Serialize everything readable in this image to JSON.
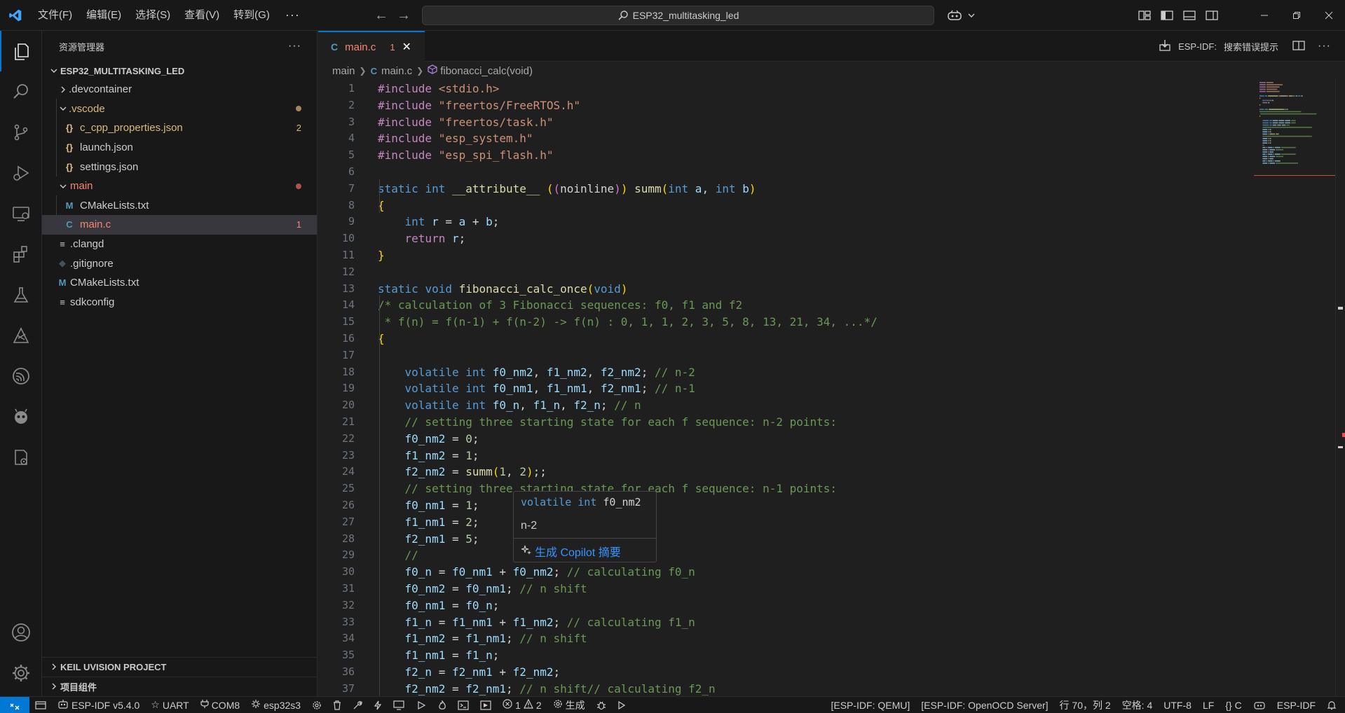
{
  "titlebar": {
    "menus": [
      "文件(F)",
      "编辑(E)",
      "选择(S)",
      "查看(V)",
      "转到(G)"
    ],
    "more": "···",
    "search_text": "ESP32_multitasking_led"
  },
  "sidebar": {
    "title": "资源管理器",
    "more": "···",
    "project": "ESP32_MULTITASKING_LED",
    "items": [
      {
        "label": ".devcontainer",
        "badge": ""
      },
      {
        "label": ".vscode",
        "badge": ""
      },
      {
        "label": "c_cpp_properties.json",
        "badge": "2"
      },
      {
        "label": "launch.json",
        "badge": ""
      },
      {
        "label": "settings.json",
        "badge": ""
      },
      {
        "label": "main",
        "badge": ""
      },
      {
        "label": "CMakeLists.txt",
        "badge": ""
      },
      {
        "label": "main.c",
        "badge": "1"
      },
      {
        "label": ".clangd",
        "badge": ""
      },
      {
        "label": ".gitignore",
        "badge": ""
      },
      {
        "label": "CMakeLists.txt",
        "badge": ""
      },
      {
        "label": "sdkconfig",
        "badge": ""
      }
    ],
    "sections": [
      "KEIL UVISION PROJECT",
      "项目组件"
    ]
  },
  "tab": {
    "icon": "C",
    "name": "main.c",
    "problems": "1",
    "close": "✕"
  },
  "editor_actions": {
    "label": "ESP-IDF:",
    "search": "搜索错误提示"
  },
  "breadcrumb": {
    "folder": "main",
    "file": "main.c",
    "symbol": "fibonacci_calc(void)"
  },
  "code": {
    "lines": [
      [
        [
          "#include ",
          "pre"
        ],
        [
          "<stdio.h>",
          "str"
        ]
      ],
      [
        [
          "#include ",
          "pre"
        ],
        [
          "\"freertos/FreeRTOS.h\"",
          "str"
        ]
      ],
      [
        [
          "#include ",
          "pre"
        ],
        [
          "\"freertos/task.h\"",
          "str"
        ]
      ],
      [
        [
          "#include ",
          "pre"
        ],
        [
          "\"esp_system.h\"",
          "str"
        ]
      ],
      [
        [
          "#include ",
          "pre"
        ],
        [
          "\"esp_spi_flash.h\"",
          "str"
        ]
      ],
      [],
      [
        [
          "static ",
          "kw"
        ],
        [
          "int ",
          "kw"
        ],
        [
          "__attribute__ ",
          "fn"
        ],
        [
          "(",
          "br1"
        ],
        [
          "(",
          "br2"
        ],
        [
          "noinline",
          "plain"
        ],
        [
          ")",
          "br2"
        ],
        [
          ")",
          "br1"
        ],
        [
          " summ",
          "fn"
        ],
        [
          "(",
          "br1"
        ],
        [
          "int ",
          "kw"
        ],
        [
          "a",
          "var"
        ],
        [
          ", ",
          "plain"
        ],
        [
          "int ",
          "kw"
        ],
        [
          "b",
          "var"
        ],
        [
          ")",
          "br1"
        ]
      ],
      [
        [
          "{",
          "br1"
        ]
      ],
      [
        [
          "    int ",
          "kw"
        ],
        [
          "r",
          "var"
        ],
        [
          " = ",
          "plain"
        ],
        [
          "a",
          "var"
        ],
        [
          " + ",
          "plain"
        ],
        [
          "b",
          "var"
        ],
        [
          ";",
          "plain"
        ]
      ],
      [
        [
          "    return ",
          "ctl"
        ],
        [
          "r",
          "var"
        ],
        [
          ";",
          "plain"
        ]
      ],
      [
        [
          "}",
          "br1"
        ]
      ],
      [],
      [
        [
          "static ",
          "kw"
        ],
        [
          "void ",
          "kw"
        ],
        [
          "fibonacci_calc_once",
          "fn"
        ],
        [
          "(",
          "br1"
        ],
        [
          "void",
          "kw"
        ],
        [
          ")",
          "br1"
        ]
      ],
      [
        [
          "/* calculation of 3 Fibonacci sequences: f0, f1 and f2",
          "cmt"
        ]
      ],
      [
        [
          " * f(n) = f(n-1) + f(n-2) -> f(n) : 0, 1, 1, 2, 3, 5, 8, 13, 21, 34, ...*/",
          "cmt"
        ]
      ],
      [
        [
          "{",
          "br1"
        ]
      ],
      [],
      [
        [
          "    volatile ",
          "kw"
        ],
        [
          "int ",
          "kw"
        ],
        [
          "f0_nm2",
          "var"
        ],
        [
          ", ",
          "plain"
        ],
        [
          "f1_nm2",
          "var"
        ],
        [
          ", ",
          "plain"
        ],
        [
          "f2_nm2",
          "var"
        ],
        [
          "; ",
          "plain"
        ],
        [
          "// n-2",
          "cmt"
        ]
      ],
      [
        [
          "    volatile ",
          "kw"
        ],
        [
          "int ",
          "kw"
        ],
        [
          "f0_nm1",
          "var"
        ],
        [
          ", ",
          "plain"
        ],
        [
          "f1_nm1",
          "var"
        ],
        [
          ", ",
          "plain"
        ],
        [
          "f2_nm1",
          "var"
        ],
        [
          "; ",
          "plain"
        ],
        [
          "// n-1",
          "cmt"
        ]
      ],
      [
        [
          "    volatile ",
          "kw"
        ],
        [
          "int ",
          "kw"
        ],
        [
          "f0_n",
          "var"
        ],
        [
          ", ",
          "plain"
        ],
        [
          "f1_n",
          "var"
        ],
        [
          ", ",
          "plain"
        ],
        [
          "f2_n",
          "var"
        ],
        [
          "; ",
          "plain"
        ],
        [
          "// n",
          "cmt"
        ]
      ],
      [
        [
          "    // setting three starting state for each f sequence: n-2 points:",
          "cmt"
        ]
      ],
      [
        [
          "    f0_nm2",
          "var"
        ],
        [
          " = ",
          "plain"
        ],
        [
          "0",
          "num"
        ],
        [
          ";",
          "plain"
        ]
      ],
      [
        [
          "    f1_nm2",
          "var"
        ],
        [
          " = ",
          "plain"
        ],
        [
          "1",
          "num"
        ],
        [
          ";",
          "plain"
        ]
      ],
      [
        [
          "    f2_nm2",
          "var"
        ],
        [
          " = ",
          "plain"
        ],
        [
          "summ",
          "fn"
        ],
        [
          "(",
          "br1"
        ],
        [
          "1",
          "num"
        ],
        [
          ", ",
          "plain"
        ],
        [
          "2",
          "num"
        ],
        [
          ")",
          "br1"
        ],
        [
          ";;",
          "plain"
        ]
      ],
      [
        [
          "    // setting three starting state for each f sequence: n-1 points:",
          "cmt"
        ]
      ],
      [
        [
          "    f0_nm1",
          "var"
        ],
        [
          " = ",
          "plain"
        ],
        [
          "1",
          "num"
        ],
        [
          ";",
          "plain"
        ]
      ],
      [
        [
          "    f1_nm1",
          "var"
        ],
        [
          " = ",
          "plain"
        ],
        [
          "2",
          "num"
        ],
        [
          ";",
          "plain"
        ]
      ],
      [
        [
          "    f2_nm1",
          "var"
        ],
        [
          " = ",
          "plain"
        ],
        [
          "5",
          "num"
        ],
        [
          ";",
          "plain"
        ]
      ],
      [
        [
          "    //",
          "cmt"
        ]
      ],
      [
        [
          "    f0_n",
          "var"
        ],
        [
          " = ",
          "plain"
        ],
        [
          "f0_nm1",
          "var"
        ],
        [
          " + ",
          "plain"
        ],
        [
          "f0_nm2",
          "var"
        ],
        [
          "; ",
          "plain"
        ],
        [
          "// calculating f0_n",
          "cmt"
        ]
      ],
      [
        [
          "    f0_nm2",
          "var"
        ],
        [
          " = ",
          "plain"
        ],
        [
          "f0_nm1",
          "var"
        ],
        [
          "; ",
          "plain"
        ],
        [
          "// n shift",
          "cmt"
        ]
      ],
      [
        [
          "    f0_nm1",
          "var"
        ],
        [
          " = ",
          "plain"
        ],
        [
          "f0_n",
          "var"
        ],
        [
          ";",
          "plain"
        ]
      ],
      [
        [
          "    f1_n",
          "var"
        ],
        [
          " = ",
          "plain"
        ],
        [
          "f1_nm1",
          "var"
        ],
        [
          " + ",
          "plain"
        ],
        [
          "f1_nm2",
          "var"
        ],
        [
          "; ",
          "plain"
        ],
        [
          "// calculating f1_n",
          "cmt"
        ]
      ],
      [
        [
          "    f1_nm2",
          "var"
        ],
        [
          " = ",
          "plain"
        ],
        [
          "f1_nm1",
          "var"
        ],
        [
          "; ",
          "plain"
        ],
        [
          "// n shift",
          "cmt"
        ]
      ],
      [
        [
          "    f1_nm1",
          "var"
        ],
        [
          " = ",
          "plain"
        ],
        [
          "f1_n",
          "var"
        ],
        [
          ";",
          "plain"
        ]
      ],
      [
        [
          "    f2_n",
          "var"
        ],
        [
          " = ",
          "plain"
        ],
        [
          "f2_nm1",
          "var"
        ],
        [
          " + ",
          "plain"
        ],
        [
          "f2_nm2",
          "var"
        ],
        [
          ";",
          "plain"
        ]
      ],
      [
        [
          "    f2_nm2",
          "var"
        ],
        [
          " = ",
          "plain"
        ],
        [
          "f2_nm1",
          "var"
        ],
        [
          "; ",
          "plain"
        ],
        [
          "// n shift// calculating f2_n",
          "cmt"
        ]
      ]
    ]
  },
  "hover": {
    "sig_kw": "volatile int",
    "sig_name": "f0_nm2",
    "doc": "n-2",
    "link": "生成 Copilot 摘要"
  },
  "statusbar": {
    "idf_version": "ESP-IDF v5.4.0",
    "uart": "UART",
    "port": "COM8",
    "target": "esp32s3",
    "errors": "1",
    "warnings": "2",
    "build": "生成",
    "qemu": "[ESP-IDF: QEMU]",
    "openocd": "[ESP-IDF: OpenOCD Server]",
    "position": "行 70，列 2",
    "spaces": "空格: 4",
    "encoding": "UTF-8",
    "eol": "LF",
    "language": "C",
    "idf": "ESP-IDF"
  },
  "colors": {
    "accent": "#0078d4",
    "modified": "#f48771",
    "badge_dot": "#a8865a"
  }
}
